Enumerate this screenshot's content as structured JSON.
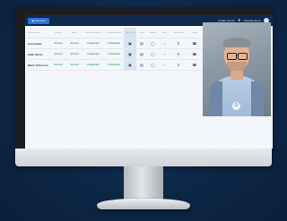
{
  "header": {
    "back_label": "Overview",
    "user_text": "Jordan Jan Dr.",
    "company_text": "Hospital Name"
  },
  "table": {
    "columns": [
      "Patient Name",
      "Arrived",
      "Intake",
      "Vitals Assessment",
      "Discharge Notes",
      "Video Call",
      "Chat",
      "History",
      "Labs",
      "Scheduled",
      "Contact"
    ],
    "rows": [
      {
        "name": "Carol Stein",
        "arrived": "Arrived",
        "intake": "Arrived",
        "vitals": "Completed",
        "notes": "Completed"
      },
      {
        "name": "Faith Stone",
        "arrived": "Arrived",
        "intake": "Arrived",
        "vitals": "Completed",
        "notes": "Completed"
      },
      {
        "name": "Marie Ockerson",
        "arrived": "Arrived",
        "intake": "Arrived",
        "vitals": "Completed",
        "notes": "Completed"
      }
    ]
  },
  "icons": {
    "video": "video-icon",
    "chat": "chat-icon",
    "history": "history-icon",
    "labs": "labs-icon",
    "scheduled": "user-icon",
    "contact": "phone-icon"
  },
  "colors": {
    "header_bg": "#0f2a4d",
    "accent": "#2b6fd6",
    "status_green": "#2fa84f"
  }
}
